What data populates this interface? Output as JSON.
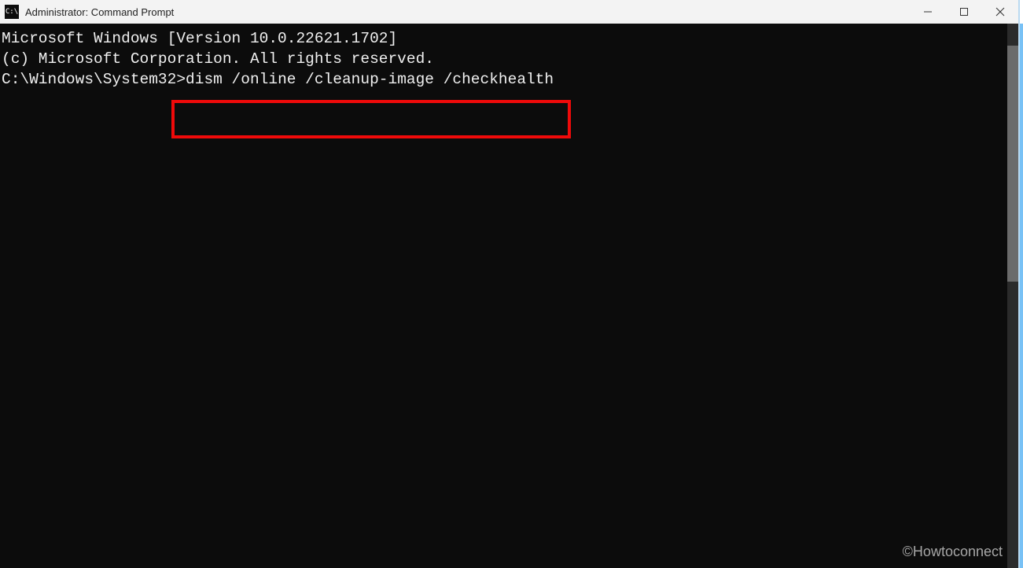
{
  "window": {
    "app_icon_text": "C:\\",
    "title": "Administrator: Command Prompt"
  },
  "console": {
    "line1": "Microsoft Windows [Version 10.0.22621.1702]",
    "line2": "(c) Microsoft Corporation. All rights reserved.",
    "blank": "",
    "prompt": "C:\\Windows\\System32>",
    "command": "dism /online /cleanup-image /checkhealth"
  },
  "watermark": "©Howtoconnect"
}
